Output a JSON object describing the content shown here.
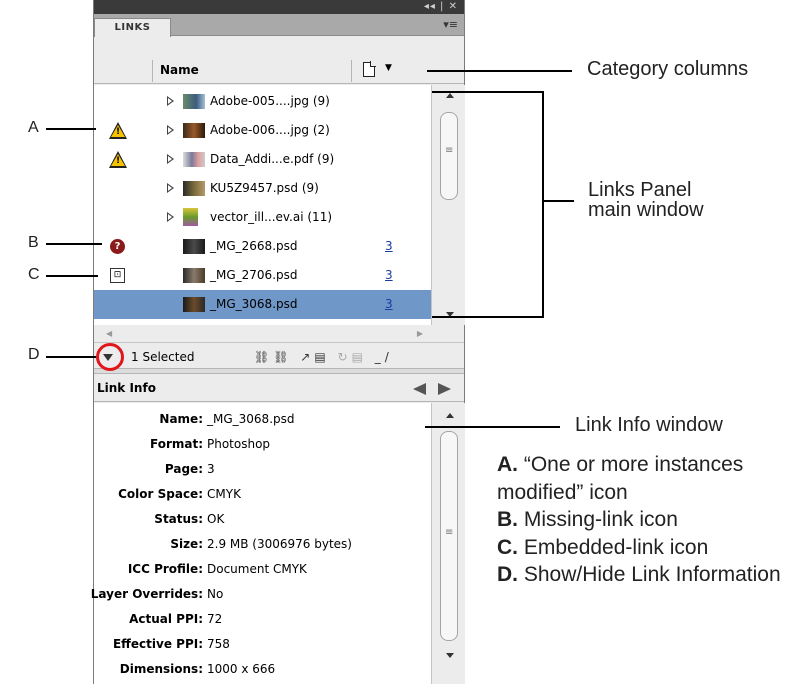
{
  "panel": {
    "tab_label": "LINKS",
    "title_controls": "◂◂ | ✕",
    "menu_icon": "panel-menu-icon",
    "column_header": "Name",
    "selected_count": "1 Selected",
    "info_title": "Link Info"
  },
  "links": [
    {
      "status": "",
      "nested": true,
      "name": "Adobe-005....jpg (9)",
      "page": ""
    },
    {
      "status": "warning-icon",
      "nested": true,
      "name": "Adobe-006....jpg (2)",
      "page": ""
    },
    {
      "status": "warning-icon",
      "nested": true,
      "name": "Data_Addi...e.pdf (9)",
      "page": ""
    },
    {
      "status": "",
      "nested": true,
      "name": "KU5Z9457.psd (9)",
      "page": ""
    },
    {
      "status": "",
      "nested": true,
      "name": "vector_ill...ev.ai (11)",
      "page": ""
    },
    {
      "status": "missing-link-icon",
      "nested": false,
      "name": "_MG_2668.psd",
      "page": "3"
    },
    {
      "status": "embedded-link-icon",
      "nested": false,
      "name": "_MG_2706.psd",
      "page": "3"
    },
    {
      "status": "",
      "nested": false,
      "name": "_MG_3068.psd",
      "page": "3",
      "selected": true
    }
  ],
  "link_info": [
    {
      "key": "Name:",
      "value": "_MG_3068.psd"
    },
    {
      "key": "Format:",
      "value": "Photoshop"
    },
    {
      "key": "Page:",
      "value": "3"
    },
    {
      "key": "Color Space:",
      "value": "CMYK"
    },
    {
      "key": "Status:",
      "value": "OK"
    },
    {
      "key": "Size:",
      "value": "2.9 MB (3006976 bytes)"
    },
    {
      "key": "ICC Profile:",
      "value": "Document CMYK"
    },
    {
      "key": "Layer Overrides:",
      "value": "No"
    },
    {
      "key": "Actual PPI:",
      "value": "72"
    },
    {
      "key": "Effective PPI:",
      "value": "758"
    },
    {
      "key": "Dimensions:",
      "value": "1000 x 666"
    }
  ],
  "annotations": {
    "category_columns": "Category columns",
    "links_panel_line1": "Links Panel",
    "links_panel_line2": "main window",
    "link_info_window": "Link Info window",
    "a": "A",
    "b": "B",
    "c": "C",
    "d": "D"
  },
  "legend": {
    "a_letter": "A.",
    "a_text": " “One or more instances modified” icon",
    "b_letter": "B.",
    "b_text": " Missing-link icon",
    "c_letter": "C.",
    "c_text": " Embedded-link icon",
    "d_letter": "D.",
    "d_text": " Show/Hide Link Information"
  },
  "colors": {
    "selection": "#6f97c7",
    "warning": "#f5c400",
    "missing": "#8b1a1a",
    "highlight_ring": "#e0161b"
  }
}
